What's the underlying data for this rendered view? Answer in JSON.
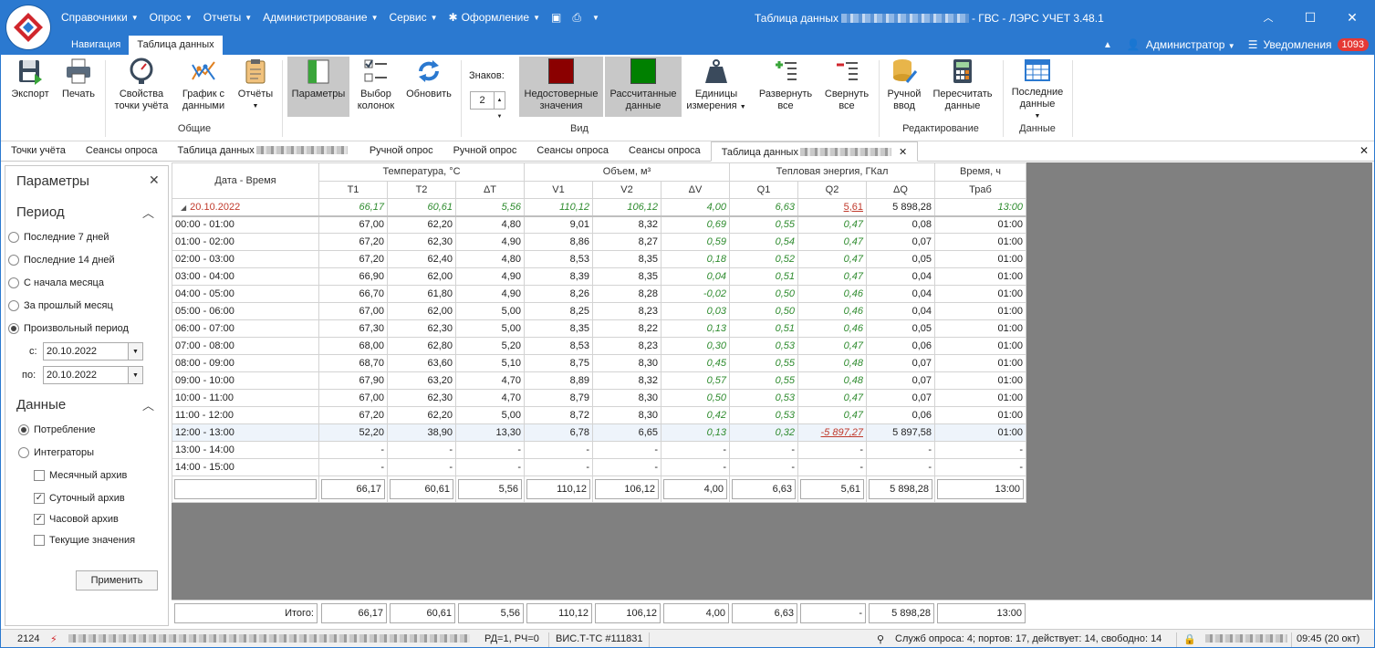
{
  "menu": [
    "Справочники",
    "Опрос",
    "Отчеты",
    "Администрирование",
    "Сервис",
    "Оформление"
  ],
  "window_title": {
    "prefix": "Таблица данных",
    "suffix": "- ГВС - ЛЭРС УЧЕТ 3.48.1"
  },
  "nav_tabs": [
    "Навигация",
    "Таблица данных"
  ],
  "user": "Администратор",
  "notifications": {
    "label": "Уведомления",
    "count": "1093"
  },
  "ribbon": {
    "export": "Экспорт",
    "print": "Печать",
    "props": "Свойства точки учёта",
    "chart": "График с данными",
    "reports": "Отчёты",
    "params": "Параметры",
    "columns": "Выбор колонок",
    "refresh": "Обновить",
    "digits_label": "Знаков:",
    "digits_value": "2",
    "unreliable": "Недостоверные значения",
    "calculated": "Рассчитанные данные",
    "units": "Единицы измерения",
    "expand": "Развернуть все",
    "collapse": "Свернуть все",
    "manual": "Ручной ввод",
    "recalc": "Пересчитать данные",
    "last": "Последние данные",
    "groups": {
      "general": "Общие",
      "view": "Вид",
      "edit": "Редактирование",
      "data": "Данные"
    }
  },
  "doc_tabs": [
    "Точки учёта",
    "Сеансы опроса",
    "Таблица данных",
    "Ручной опрос",
    "Ручной опрос",
    "Сеансы опроса",
    "Сеансы опроса",
    "Таблица данных"
  ],
  "left_panel": {
    "title": "Параметры",
    "period_title": "Период",
    "periods": [
      "Последние 7 дней",
      "Последние 14 дней",
      "С начала месяца",
      "За прошлый месяц",
      "Произвольный период"
    ],
    "from_label": "с:",
    "from_value": "20.10.2022",
    "to_label": "по:",
    "to_value": "20.10.2022",
    "data_title": "Данные",
    "modes": [
      "Потребление",
      "Интеграторы"
    ],
    "archives": [
      {
        "label": "Месячный архив",
        "checked": false
      },
      {
        "label": "Суточный архив",
        "checked": true
      },
      {
        "label": "Часовой архив",
        "checked": true
      },
      {
        "label": "Текущие значения",
        "checked": false
      }
    ],
    "apply": "Применить"
  },
  "grid": {
    "col_datetime": "Дата - Время",
    "groups": [
      "Температура, °С",
      "Объем, м³",
      "Тепловая энергия, ГКал",
      "Время, ч"
    ],
    "cols": [
      "T1",
      "T2",
      "ΔT",
      "V1",
      "V2",
      "ΔV",
      "Q1",
      "Q2",
      "ΔQ",
      "Траб"
    ],
    "day": {
      "label": "20.10.2022",
      "values": [
        "66,17",
        "60,61",
        "5,56",
        "110,12",
        "106,12",
        "4,00",
        "6,63",
        "5,61",
        "5 898,28",
        "13:00"
      ]
    },
    "rows": [
      {
        "time": "00:00 - 01:00",
        "v": [
          "67,00",
          "62,20",
          "4,80",
          "9,01",
          "8,32",
          "0,69",
          "0,55",
          "0,47",
          "0,08",
          "01:00"
        ]
      },
      {
        "time": "01:00 - 02:00",
        "v": [
          "67,20",
          "62,30",
          "4,90",
          "8,86",
          "8,27",
          "0,59",
          "0,54",
          "0,47",
          "0,07",
          "01:00"
        ]
      },
      {
        "time": "02:00 - 03:00",
        "v": [
          "67,20",
          "62,40",
          "4,80",
          "8,53",
          "8,35",
          "0,18",
          "0,52",
          "0,47",
          "0,05",
          "01:00"
        ]
      },
      {
        "time": "03:00 - 04:00",
        "v": [
          "66,90",
          "62,00",
          "4,90",
          "8,39",
          "8,35",
          "0,04",
          "0,51",
          "0,47",
          "0,04",
          "01:00"
        ]
      },
      {
        "time": "04:00 - 05:00",
        "v": [
          "66,70",
          "61,80",
          "4,90",
          "8,26",
          "8,28",
          "-0,02",
          "0,50",
          "0,46",
          "0,04",
          "01:00"
        ]
      },
      {
        "time": "05:00 - 06:00",
        "v": [
          "67,00",
          "62,00",
          "5,00",
          "8,25",
          "8,23",
          "0,03",
          "0,50",
          "0,46",
          "0,04",
          "01:00"
        ]
      },
      {
        "time": "06:00 - 07:00",
        "v": [
          "67,30",
          "62,30",
          "5,00",
          "8,35",
          "8,22",
          "0,13",
          "0,51",
          "0,46",
          "0,05",
          "01:00"
        ]
      },
      {
        "time": "07:00 - 08:00",
        "v": [
          "68,00",
          "62,80",
          "5,20",
          "8,53",
          "8,23",
          "0,30",
          "0,53",
          "0,47",
          "0,06",
          "01:00"
        ]
      },
      {
        "time": "08:00 - 09:00",
        "v": [
          "68,70",
          "63,60",
          "5,10",
          "8,75",
          "8,30",
          "0,45",
          "0,55",
          "0,48",
          "0,07",
          "01:00"
        ]
      },
      {
        "time": "09:00 - 10:00",
        "v": [
          "67,90",
          "63,20",
          "4,70",
          "8,89",
          "8,32",
          "0,57",
          "0,55",
          "0,48",
          "0,07",
          "01:00"
        ]
      },
      {
        "time": "10:00 - 11:00",
        "v": [
          "67,00",
          "62,30",
          "4,70",
          "8,79",
          "8,30",
          "0,50",
          "0,53",
          "0,47",
          "0,07",
          "01:00"
        ]
      },
      {
        "time": "11:00 - 12:00",
        "v": [
          "67,20",
          "62,20",
          "5,00",
          "8,72",
          "8,30",
          "0,42",
          "0,53",
          "0,47",
          "0,06",
          "01:00"
        ]
      },
      {
        "time": "12:00 - 13:00",
        "v": [
          "52,20",
          "38,90",
          "13,30",
          "6,78",
          "6,65",
          "0,13",
          "0,32",
          "-5 897,27",
          "5 897,58",
          "01:00"
        ]
      },
      {
        "time": "13:00 - 14:00",
        "v": [
          "-",
          "-",
          "-",
          "-",
          "-",
          "-",
          "-",
          "-",
          "-",
          "-"
        ]
      },
      {
        "time": "14:00 - 15:00",
        "v": [
          "-",
          "-",
          "-",
          "-",
          "-",
          "-",
          "-",
          "-",
          "-",
          "-"
        ]
      }
    ],
    "summary": [
      "66,17",
      "60,61",
      "5,56",
      "110,12",
      "106,12",
      "4,00",
      "6,63",
      "5,61",
      "5 898,28",
      "13:00"
    ],
    "total_label": "Итого:",
    "total": [
      "66,17",
      "60,61",
      "5,56",
      "110,12",
      "106,12",
      "4,00",
      "6,63",
      "-",
      "5 898,28",
      "13:00"
    ]
  },
  "status": {
    "id": "2124",
    "rd": "РД=1, РЧ=0",
    "device": "ВИС.Т-ТС #111831",
    "services": "Служб опроса: 4; портов: 17, действует: 14, свободно: 14",
    "time": "09:45 (20 окт)"
  },
  "colors": {
    "accent": "#2b79d0",
    "unreliable": "#8b0000",
    "calculated": "#008000",
    "green_text": "#2e8b2e",
    "red_text": "#c0392b"
  }
}
